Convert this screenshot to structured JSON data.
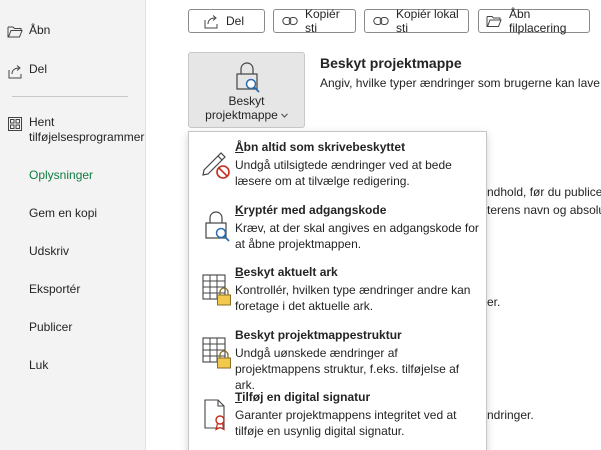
{
  "sidebar": {
    "open_label": "Åbn",
    "share_label": "Del",
    "addins_line1": "Hent",
    "addins_line2": "tilføjelsesprogrammer",
    "info_label": "Oplysninger",
    "save_copy_label": "Gem en kopi",
    "print_label": "Udskriv",
    "export_label": "Eksportér",
    "publish_label": "Publicer",
    "close_label": "Luk"
  },
  "toolbar": {
    "share_label": "Del",
    "copy_path_label": "Kopiér sti",
    "copy_local_path_label": "Kopiér lokal sti",
    "open_location_label": "Åbn filplacering"
  },
  "protect": {
    "button_line1": "Beskyt",
    "button_line2": "projektmappe",
    "title": "Beskyt projektmappe",
    "description": "Angiv, hvilke typer ændringer som brugerne kan lave i pr"
  },
  "background_fragments": {
    "frag1": "ndhold, før du publicer",
    "frag2": "terens navn og absolut",
    "frag3": "er.",
    "frag4": "ndringer."
  },
  "menu": {
    "items": [
      {
        "title_first": "Å",
        "title_rest": "bn altid som skrivebeskyttet",
        "desc_line1": "Undgå utilsigtede ændringer ved at bede",
        "desc_line2": "læsere om at tilvælge redigering."
      },
      {
        "title_first": "K",
        "title_rest": "ryptér med adgangskode",
        "desc_line1": "Kræv, at der skal angives en adgangskode for",
        "desc_line2": "at åbne projektmappen."
      },
      {
        "title_first": "B",
        "title_rest": "eskyt aktuelt ark",
        "desc_line1": "Kontrollér, hvilken type ændringer andre kan",
        "desc_line2": "foretage i det aktuelle ark."
      },
      {
        "title_first": "",
        "title_rest": "Beskyt projektmappestruktur",
        "desc_line1": "Undgå uønskede ændringer af",
        "desc_line2": "projektmappens struktur, f.eks. tilføjelse af ark."
      },
      {
        "title_first": "T",
        "title_rest": "ilføj en digital signatur",
        "desc_line1": "Garanter projektmappens integritet ved at",
        "desc_line2": "tilføje en usynlig digital signatur."
      }
    ]
  },
  "colors": {
    "accent_green": "#107c41",
    "sidebar_bg": "#f3f3f3"
  }
}
